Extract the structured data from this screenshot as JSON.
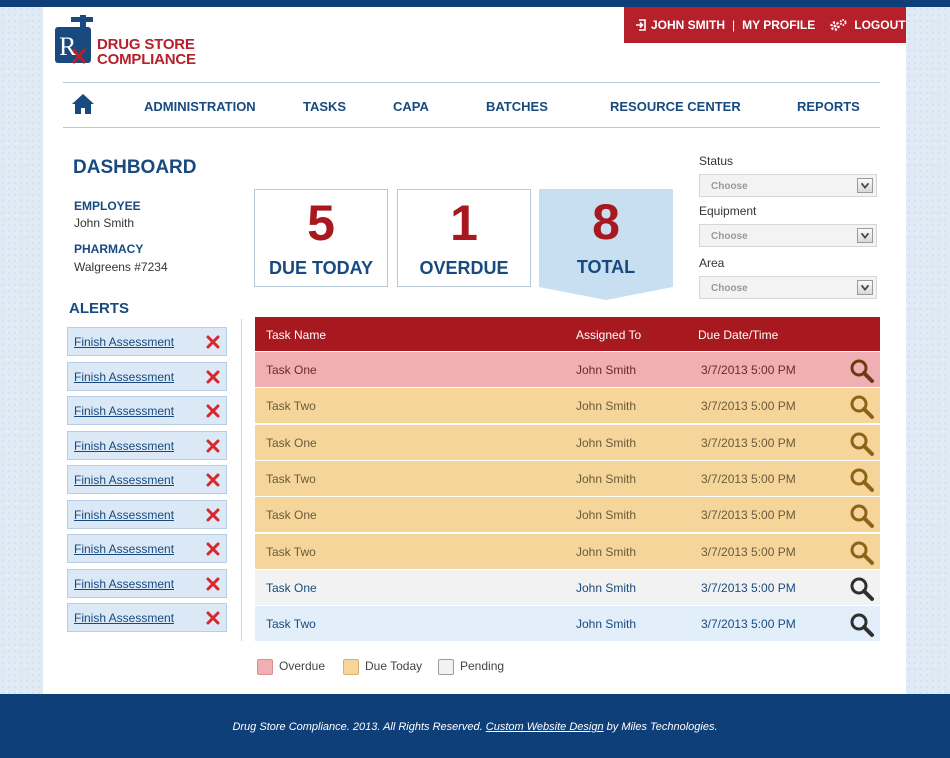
{
  "brand": {
    "line1": "DRUG STORE",
    "line2": "COMPLIANCE"
  },
  "userbar": {
    "user": "JOHN SMITH",
    "separator": "|",
    "profile": "MY PROFILE",
    "logout": "LOGOUT"
  },
  "nav": {
    "items": [
      "ADMINISTRATION",
      "TASKS",
      "CAPA",
      "BATCHES",
      "RESOURCE CENTER",
      "REPORTS"
    ]
  },
  "dashboard": {
    "title": "DASHBOARD",
    "employee_label": "EMPLOYEE",
    "employee_value": "John Smith",
    "pharmacy_label": "PHARMACY",
    "pharmacy_value": "Walgreens #7234"
  },
  "stats": [
    {
      "value": "5",
      "label": "DUE TODAY"
    },
    {
      "value": "1",
      "label": "OVERDUE"
    },
    {
      "value": "8",
      "label": "TOTAL"
    }
  ],
  "filters": [
    {
      "label": "Status",
      "placeholder": "Choose"
    },
    {
      "label": "Equipment",
      "placeholder": "Choose"
    },
    {
      "label": "Area",
      "placeholder": "Choose"
    }
  ],
  "alerts": {
    "title": "ALERTS",
    "items": [
      "Finish Assessment",
      "Finish Assessment",
      "Finish Assessment",
      "Finish Assessment",
      "Finish Assessment",
      "Finish Assessment",
      "Finish Assessment",
      "Finish Assessment",
      "Finish Assessment"
    ]
  },
  "table": {
    "headers": [
      "Task Name",
      "Assigned To",
      "Due Date/Time"
    ],
    "rows": [
      {
        "task": "Task One",
        "assigned": "John Smith",
        "due": "3/7/2013 5:00 PM",
        "status": "overdue"
      },
      {
        "task": "Task Two",
        "assigned": "John Smith",
        "due": "3/7/2013 5:00 PM",
        "status": "due-today"
      },
      {
        "task": "Task One",
        "assigned": "John Smith",
        "due": "3/7/2013 5:00 PM",
        "status": "due-today"
      },
      {
        "task": "Task Two",
        "assigned": "John Smith",
        "due": "3/7/2013 5:00 PM",
        "status": "due-today"
      },
      {
        "task": "Task One",
        "assigned": "John Smith",
        "due": "3/7/2013 5:00 PM",
        "status": "due-today"
      },
      {
        "task": "Task Two",
        "assigned": "John Smith",
        "due": "3/7/2013 5:00 PM",
        "status": "due-today"
      },
      {
        "task": "Task One",
        "assigned": "John Smith",
        "due": "3/7/2013 5:00 PM",
        "status": "pending"
      },
      {
        "task": "Task Two",
        "assigned": "John Smith",
        "due": "3/7/2013 5:00 PM",
        "status": "pending"
      }
    ]
  },
  "legend": [
    {
      "label": "Overdue",
      "color": "#f0b0b3"
    },
    {
      "label": "Due Today",
      "color": "#f5d59a"
    },
    {
      "label": "Pending",
      "color": "#f2f2f2"
    }
  ],
  "colors": {
    "brand_red": "#b5202a",
    "brand_blue": "#184a80",
    "row_overdue": "#f0b0b3",
    "row_due_today": "#f5d59a",
    "row_pending_a": "#f2f2f2",
    "row_pending_b": "#e2eef9"
  },
  "footer": {
    "text_before": "Drug Store Compliance. 2013. All Rights Reserved.",
    "link": "Custom Website Design",
    "text_after": "by Miles Technologies."
  }
}
